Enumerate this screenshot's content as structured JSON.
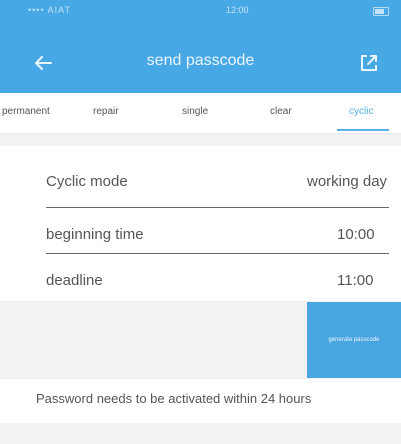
{
  "status_bar": {
    "carrier": "•••• AIAT",
    "time": "12:00"
  },
  "header": {
    "title": "send passcode",
    "back_icon": "arrow-left-icon",
    "share_icon": "share-icon",
    "color": "#48a8e6"
  },
  "tabs": [
    {
      "label": "permanent",
      "active": false
    },
    {
      "label": "repair",
      "active": false
    },
    {
      "label": "single",
      "active": false
    },
    {
      "label": "clear",
      "active": false
    },
    {
      "label": "cyclic",
      "active": true
    }
  ],
  "form": {
    "cyclic_mode": {
      "label": "Cyclic mode",
      "value": "working day"
    },
    "beginning_time": {
      "label": "beginning time",
      "value": "10:00"
    },
    "deadline": {
      "label": "deadline",
      "value": "11:00"
    }
  },
  "generate_button": {
    "label": "generate passcode"
  },
  "note": "Password needs to be activated within 24 hours"
}
